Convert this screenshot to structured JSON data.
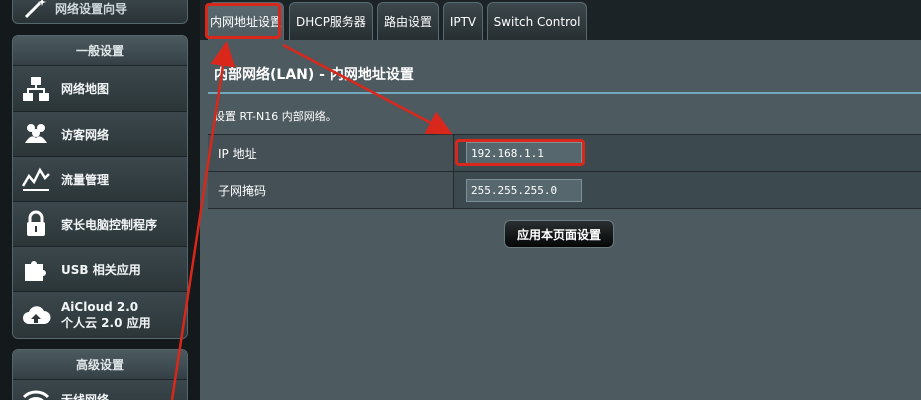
{
  "sidebar": {
    "top_item": {
      "label": "网络设置向导",
      "icon": "wand-icon"
    },
    "general": {
      "header": "一般设置",
      "items": [
        {
          "label": "网络地图",
          "icon": "network-map-icon"
        },
        {
          "label": "访客网络",
          "icon": "guest-network-icon"
        },
        {
          "label": "流量管理",
          "icon": "traffic-icon"
        },
        {
          "label": "家长电脑控制程序",
          "icon": "lock-icon"
        },
        {
          "label": "USB 相关应用",
          "icon": "puzzle-icon"
        },
        {
          "label": "AiCloud 2.0",
          "label2": "个人云 2.0 应用",
          "icon": "cloud-icon"
        }
      ]
    },
    "advanced": {
      "header": "高级设置",
      "items": [
        {
          "label": "无线网络",
          "icon": "wifi-icon"
        }
      ]
    }
  },
  "tabs": [
    {
      "label": "内网地址设置",
      "active": true
    },
    {
      "label": "DHCP服务器"
    },
    {
      "label": "路由设置"
    },
    {
      "label": "IPTV"
    },
    {
      "label": "Switch Control"
    }
  ],
  "page": {
    "title": "内部网络(LAN) - 内网地址设置",
    "description": "设置 RT-N16 内部网络。",
    "fields": [
      {
        "label": "IP 地址",
        "value": "192.168.1.1"
      },
      {
        "label": "子网掩码",
        "value": "255.255.255.0"
      }
    ],
    "apply_label": "应用本页面设置"
  },
  "colors": {
    "accent": "#6fa8bd",
    "annotation": "#d9281b",
    "panel": "#4d5a5f"
  }
}
